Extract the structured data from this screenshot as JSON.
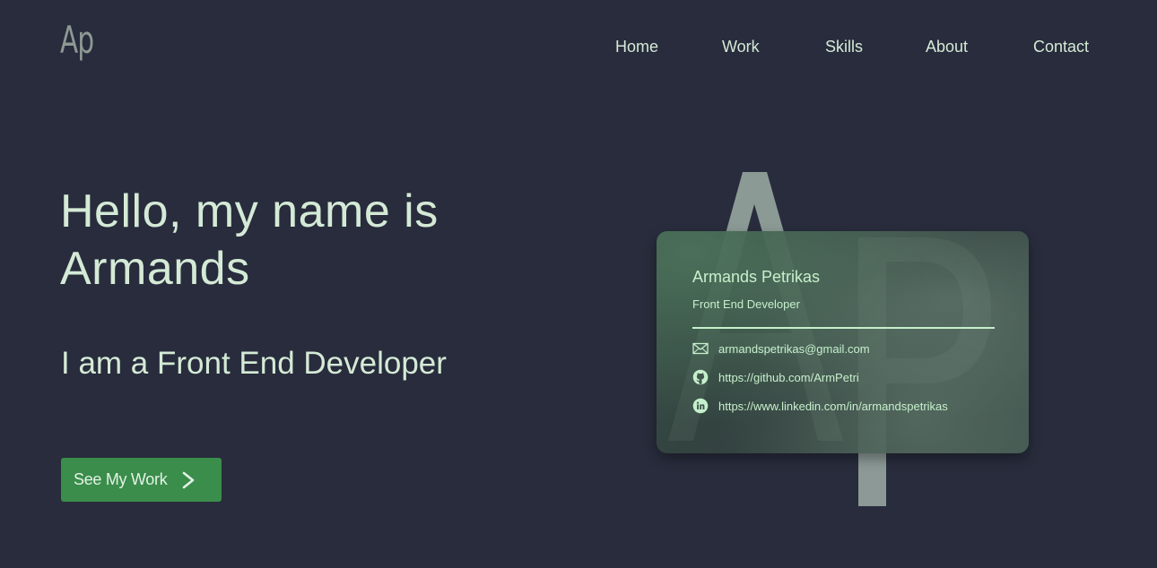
{
  "header": {
    "logo_text": "Ap",
    "nav": [
      {
        "label": "Home"
      },
      {
        "label": "Work"
      },
      {
        "label": "Skills"
      },
      {
        "label": "About"
      },
      {
        "label": "Contact"
      }
    ]
  },
  "hero": {
    "title": "Hello, my name is Armands",
    "subtitle": "I am a Front End Developer",
    "cta_label": "See My Work",
    "cta_icon": "chevron-right-icon"
  },
  "card": {
    "backdrop_monogram": "AP",
    "name": "Armands Petrikas",
    "role": "Front End Developer",
    "contacts": [
      {
        "icon": "mail-icon",
        "text": "armandspetrikas@gmail.com"
      },
      {
        "icon": "github-icon",
        "text": "https://github.com/ArmPetri"
      },
      {
        "icon": "linkedin-icon",
        "text": "https://www.linkedin.com/in/armandspetrikas"
      }
    ]
  },
  "colors": {
    "background": "#282c3c",
    "text": "#d4ead6",
    "accent": "#3a8d4b",
    "card_text": "#c6f0cc",
    "logo": "#8e9993"
  }
}
